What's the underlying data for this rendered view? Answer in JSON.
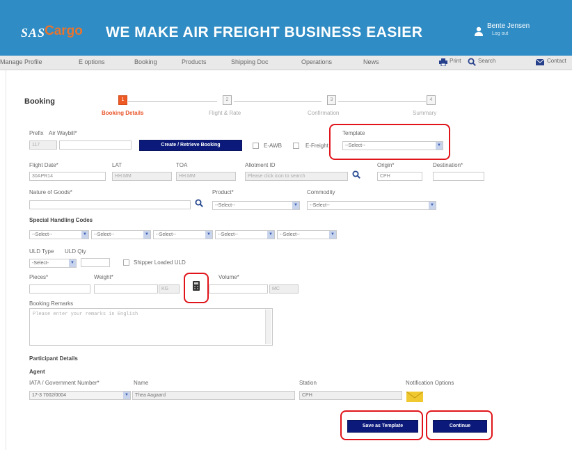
{
  "header": {
    "logo_sas": "SAS",
    "logo_cargo": "Cargo",
    "tagline": "WE MAKE AIR FREIGHT BUSINESS EASIER",
    "user_name": "Bente Jensen",
    "logout": "Log out"
  },
  "nav": {
    "items": [
      "Manage Profile",
      "E options",
      "Booking",
      "Products",
      "Shipping Doc",
      "Operations",
      "News"
    ],
    "tools": [
      "Print",
      "Search",
      "Contact"
    ]
  },
  "booking": {
    "title": "Booking",
    "steps": [
      {
        "num": "1",
        "label": "Booking Details"
      },
      {
        "num": "2",
        "label": "Flight & Rate"
      },
      {
        "num": "3",
        "label": "Confirmation"
      },
      {
        "num": "4",
        "label": "Summary"
      }
    ]
  },
  "form": {
    "prefix_label": "Prefix",
    "awb_label": "Air Waybill*",
    "prefix_value": "117",
    "create_button": "Create / Retrieve Booking",
    "eawb_label": "E-AWB",
    "efreight_label": "E-Freight",
    "template_label": "Template",
    "template_value": "--Select--",
    "flight_date_label": "Flight Date*",
    "flight_date_value": "30APR14",
    "lat_label": "LAT",
    "lat_value": "HH:MM",
    "toa_label": "TOA",
    "toa_value": "HH:MM",
    "allotment_label": "Allotment ID",
    "allotment_placeholder": "Please click icon to search",
    "origin_label": "Origin*",
    "origin_value": "CPH",
    "destination_label": "Destination*",
    "nature_label": "Nature of Goods*",
    "product_label": "Product*",
    "product_value": "--Select--",
    "commodity_label": "Commodity",
    "commodity_value": "--Select--",
    "shc_label": "Special Handling Codes",
    "shc_values": [
      "--Select--",
      "--Select--",
      "--Select--",
      "--Select--",
      "--Select--"
    ],
    "uld_type_label": "ULD Type",
    "uld_qty_label": "ULD Qty",
    "uld_type_value": "-Select-",
    "shipper_loaded_label": "Shipper Loaded ULD",
    "pieces_label": "Pieces*",
    "weight_label": "Weight*",
    "weight_unit": "KG",
    "volume_label": "Volume*",
    "volume_unit": "MC",
    "remarks_label": "Booking Remarks",
    "remarks_placeholder": "Please enter your remarks in English"
  },
  "participant": {
    "title": "Participant Details",
    "agent_label": "Agent",
    "iata_label": "IATA / Government Number*",
    "iata_value": "17-3 7002/0004",
    "name_label": "Name",
    "name_value": "Thea Aagaard",
    "station_label": "Station",
    "station_value": "CPH",
    "notification_label": "Notification Options"
  },
  "actions": {
    "save_template": "Save as Template",
    "continue": "Continue"
  },
  "colors": {
    "header_bg": "#2f8cc4",
    "accent_orange": "#ee5a24",
    "button_navy": "#0b1a7a",
    "highlight_red": "#e0141a"
  }
}
